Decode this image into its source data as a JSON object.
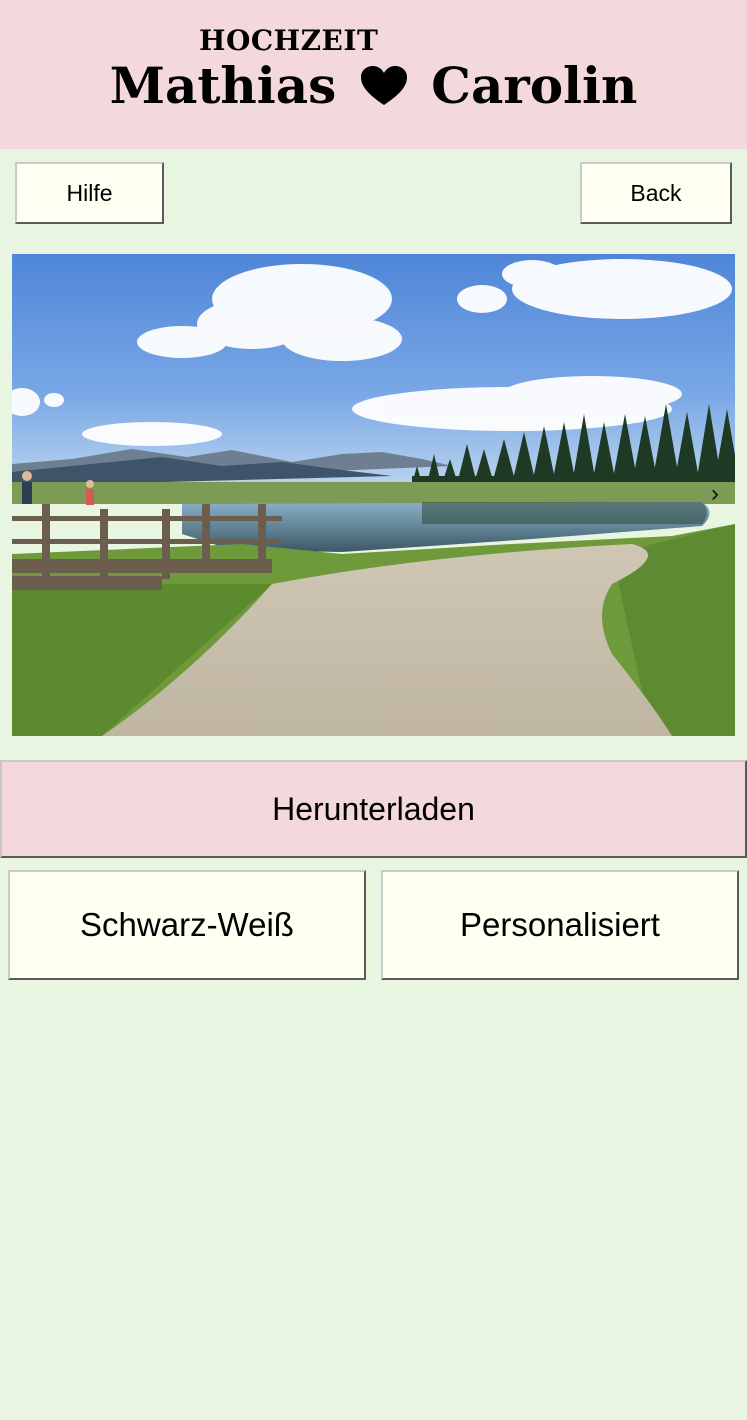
{
  "header": {
    "subtitle": "HOCHZEIT",
    "name_left": "Mathias",
    "name_right": "Carolin",
    "background": "#f3d9db"
  },
  "nav": {
    "help_label": "Hilfe",
    "back_label": "Back"
  },
  "photo": {
    "description_icon": "landscape-photo",
    "next_label": "›"
  },
  "actions": {
    "download_label": "Herunterladen",
    "bw_label": "Schwarz-Weiß",
    "personalized_label": "Personalisiert"
  },
  "colors": {
    "page_background": "#e8f5e1",
    "button_background": "#fefff0",
    "accent_pink": "#f3d9db"
  }
}
